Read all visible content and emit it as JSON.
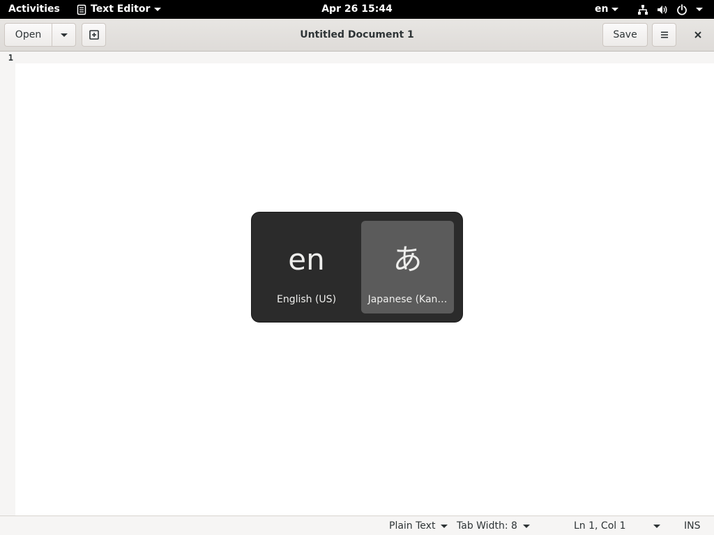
{
  "topbar": {
    "activities": "Activities",
    "app_name": "Text Editor",
    "clock": "Apr 26  15:44",
    "input_indicator": "en"
  },
  "headerbar": {
    "open_label": "Open",
    "title": "Untitled Document 1",
    "save_label": "Save"
  },
  "editor": {
    "line_numbers": [
      "1"
    ]
  },
  "statusbar": {
    "language": "Plain Text",
    "tab_width": "Tab Width: 8",
    "position": "Ln 1, Col 1",
    "mode": "INS"
  },
  "input_switcher": {
    "sources": [
      {
        "glyph": "en",
        "label": "English (US)",
        "selected": false
      },
      {
        "glyph": "あ",
        "label": "Japanese (Kan…",
        "selected": true
      }
    ]
  },
  "colors": {
    "topbar_bg": "#000000",
    "switcher_bg": "#2b2b2b",
    "switcher_selected": "#5b5b5b",
    "editor_bg": "#ffffff"
  }
}
